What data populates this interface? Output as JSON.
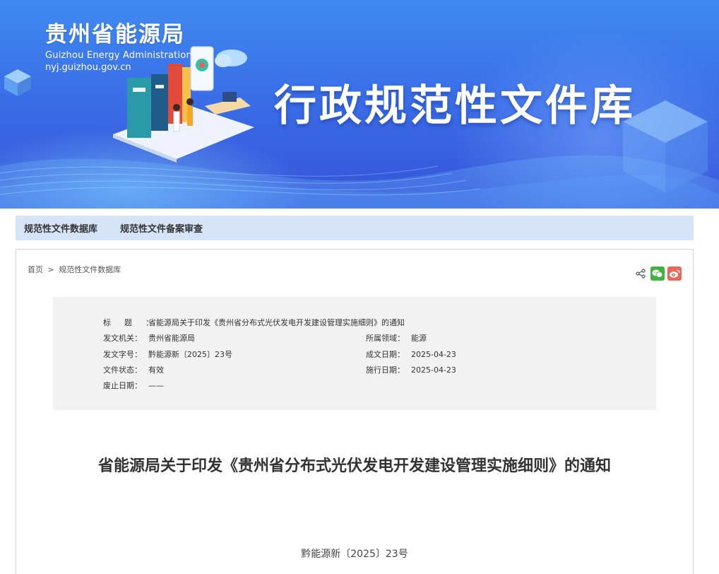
{
  "banner": {
    "org_name_cn": "贵州省能源局",
    "org_name_en": "Guizhou Energy Administration",
    "org_url": "nyj.guizhou.gov.cn",
    "title": "行政规范性文件库"
  },
  "nav": {
    "items": [
      {
        "label": "规范性文件数据库"
      },
      {
        "label": "规范性文件备案审查"
      }
    ]
  },
  "breadcrumb": {
    "home": "首页",
    "separator": ">",
    "current": "规范性文件数据库"
  },
  "share": {
    "icons": [
      "share-icon",
      "wechat-icon",
      "weibo-icon"
    ]
  },
  "info": {
    "title_label": "标题：",
    "title_value": "省能源局关于印发《贵州省分布式光伏发电开发建设管理实施细则》的通知",
    "issuer_label": "发文机关：",
    "issuer_value": "贵州省能源局",
    "domain_label": "所属领域：",
    "domain_value": "能源",
    "docno_label": "发文字号：",
    "docno_value": "黔能源新〔2025〕23号",
    "created_label": "成文日期：",
    "created_value": "2025-04-23",
    "status_label": "文件状态：",
    "status_value": "有效",
    "effective_label": "施行日期：",
    "effective_value": "2025-04-23",
    "repeal_label": "废止日期：",
    "repeal_value": "——"
  },
  "document": {
    "title": "省能源局关于印发《贵州省分布式光伏发电开发建设管理实施细则》的通知",
    "number": "黔能源新〔2025〕23号"
  },
  "colors": {
    "banner_top": "#3f8af0",
    "banner_bottom": "#3552d8",
    "nav_bg": "#d6e4f7",
    "info_bg": "#f2f2f2",
    "wechat": "#3fb23f",
    "weibo": "#e9665a"
  }
}
